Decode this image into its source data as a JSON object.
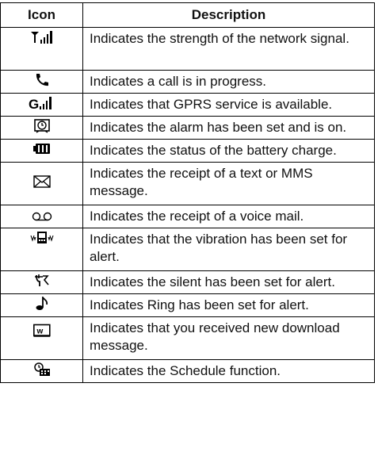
{
  "header": {
    "icon_col": "Icon",
    "desc_col": "Description"
  },
  "rows": [
    {
      "icon": "signal-strength-icon",
      "text": "Indicates the strength of the network signal."
    },
    {
      "icon": "phone-call-icon",
      "text": "Indicates a call is in progress."
    },
    {
      "icon": "gprs-icon",
      "text": "Indicates that GPRS service is available."
    },
    {
      "icon": "alarm-clock-icon",
      "text": "Indicates the alarm has been set and is on."
    },
    {
      "icon": "battery-icon",
      "text": "Indicates the status of the battery charge."
    },
    {
      "icon": "envelope-icon",
      "text": "Indicates the receipt of a text or MMS message."
    },
    {
      "icon": "voicemail-icon",
      "text": "Indicates the receipt of a voice mail."
    },
    {
      "icon": "vibration-icon",
      "text": "Indicates that the vibration has been set for alert."
    },
    {
      "icon": "silent-icon",
      "text": "Indicates the silent has been set for alert."
    },
    {
      "icon": "music-note-icon",
      "text": "Indicates Ring has been set for alert."
    },
    {
      "icon": "download-icon",
      "text": "Indicates that you received new download message."
    },
    {
      "icon": "schedule-icon",
      "text": "Indicates the Schedule function."
    }
  ]
}
